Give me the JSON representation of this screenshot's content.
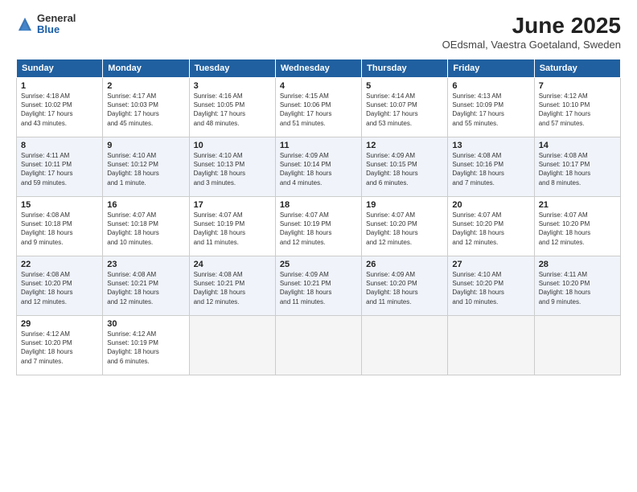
{
  "header": {
    "logo_general": "General",
    "logo_blue": "Blue",
    "title": "June 2025",
    "location": "OEdsmal, Vaestra Goetaland, Sweden"
  },
  "days_of_week": [
    "Sunday",
    "Monday",
    "Tuesday",
    "Wednesday",
    "Thursday",
    "Friday",
    "Saturday"
  ],
  "weeks": [
    [
      {
        "day": "1",
        "info": "Sunrise: 4:18 AM\nSunset: 10:02 PM\nDaylight: 17 hours\nand 43 minutes."
      },
      {
        "day": "2",
        "info": "Sunrise: 4:17 AM\nSunset: 10:03 PM\nDaylight: 17 hours\nand 45 minutes."
      },
      {
        "day": "3",
        "info": "Sunrise: 4:16 AM\nSunset: 10:05 PM\nDaylight: 17 hours\nand 48 minutes."
      },
      {
        "day": "4",
        "info": "Sunrise: 4:15 AM\nSunset: 10:06 PM\nDaylight: 17 hours\nand 51 minutes."
      },
      {
        "day": "5",
        "info": "Sunrise: 4:14 AM\nSunset: 10:07 PM\nDaylight: 17 hours\nand 53 minutes."
      },
      {
        "day": "6",
        "info": "Sunrise: 4:13 AM\nSunset: 10:09 PM\nDaylight: 17 hours\nand 55 minutes."
      },
      {
        "day": "7",
        "info": "Sunrise: 4:12 AM\nSunset: 10:10 PM\nDaylight: 17 hours\nand 57 minutes."
      }
    ],
    [
      {
        "day": "8",
        "info": "Sunrise: 4:11 AM\nSunset: 10:11 PM\nDaylight: 17 hours\nand 59 minutes."
      },
      {
        "day": "9",
        "info": "Sunrise: 4:10 AM\nSunset: 10:12 PM\nDaylight: 18 hours\nand 1 minute."
      },
      {
        "day": "10",
        "info": "Sunrise: 4:10 AM\nSunset: 10:13 PM\nDaylight: 18 hours\nand 3 minutes."
      },
      {
        "day": "11",
        "info": "Sunrise: 4:09 AM\nSunset: 10:14 PM\nDaylight: 18 hours\nand 4 minutes."
      },
      {
        "day": "12",
        "info": "Sunrise: 4:09 AM\nSunset: 10:15 PM\nDaylight: 18 hours\nand 6 minutes."
      },
      {
        "day": "13",
        "info": "Sunrise: 4:08 AM\nSunset: 10:16 PM\nDaylight: 18 hours\nand 7 minutes."
      },
      {
        "day": "14",
        "info": "Sunrise: 4:08 AM\nSunset: 10:17 PM\nDaylight: 18 hours\nand 8 minutes."
      }
    ],
    [
      {
        "day": "15",
        "info": "Sunrise: 4:08 AM\nSunset: 10:18 PM\nDaylight: 18 hours\nand 9 minutes."
      },
      {
        "day": "16",
        "info": "Sunrise: 4:07 AM\nSunset: 10:18 PM\nDaylight: 18 hours\nand 10 minutes."
      },
      {
        "day": "17",
        "info": "Sunrise: 4:07 AM\nSunset: 10:19 PM\nDaylight: 18 hours\nand 11 minutes."
      },
      {
        "day": "18",
        "info": "Sunrise: 4:07 AM\nSunset: 10:19 PM\nDaylight: 18 hours\nand 12 minutes."
      },
      {
        "day": "19",
        "info": "Sunrise: 4:07 AM\nSunset: 10:20 PM\nDaylight: 18 hours\nand 12 minutes."
      },
      {
        "day": "20",
        "info": "Sunrise: 4:07 AM\nSunset: 10:20 PM\nDaylight: 18 hours\nand 12 minutes."
      },
      {
        "day": "21",
        "info": "Sunrise: 4:07 AM\nSunset: 10:20 PM\nDaylight: 18 hours\nand 12 minutes."
      }
    ],
    [
      {
        "day": "22",
        "info": "Sunrise: 4:08 AM\nSunset: 10:20 PM\nDaylight: 18 hours\nand 12 minutes."
      },
      {
        "day": "23",
        "info": "Sunrise: 4:08 AM\nSunset: 10:21 PM\nDaylight: 18 hours\nand 12 minutes."
      },
      {
        "day": "24",
        "info": "Sunrise: 4:08 AM\nSunset: 10:21 PM\nDaylight: 18 hours\nand 12 minutes."
      },
      {
        "day": "25",
        "info": "Sunrise: 4:09 AM\nSunset: 10:21 PM\nDaylight: 18 hours\nand 11 minutes."
      },
      {
        "day": "26",
        "info": "Sunrise: 4:09 AM\nSunset: 10:20 PM\nDaylight: 18 hours\nand 11 minutes."
      },
      {
        "day": "27",
        "info": "Sunrise: 4:10 AM\nSunset: 10:20 PM\nDaylight: 18 hours\nand 10 minutes."
      },
      {
        "day": "28",
        "info": "Sunrise: 4:11 AM\nSunset: 10:20 PM\nDaylight: 18 hours\nand 9 minutes."
      }
    ],
    [
      {
        "day": "29",
        "info": "Sunrise: 4:12 AM\nSunset: 10:20 PM\nDaylight: 18 hours\nand 7 minutes."
      },
      {
        "day": "30",
        "info": "Sunrise: 4:12 AM\nSunset: 10:19 PM\nDaylight: 18 hours\nand 6 minutes."
      },
      {
        "day": "",
        "info": ""
      },
      {
        "day": "",
        "info": ""
      },
      {
        "day": "",
        "info": ""
      },
      {
        "day": "",
        "info": ""
      },
      {
        "day": "",
        "info": ""
      }
    ]
  ]
}
